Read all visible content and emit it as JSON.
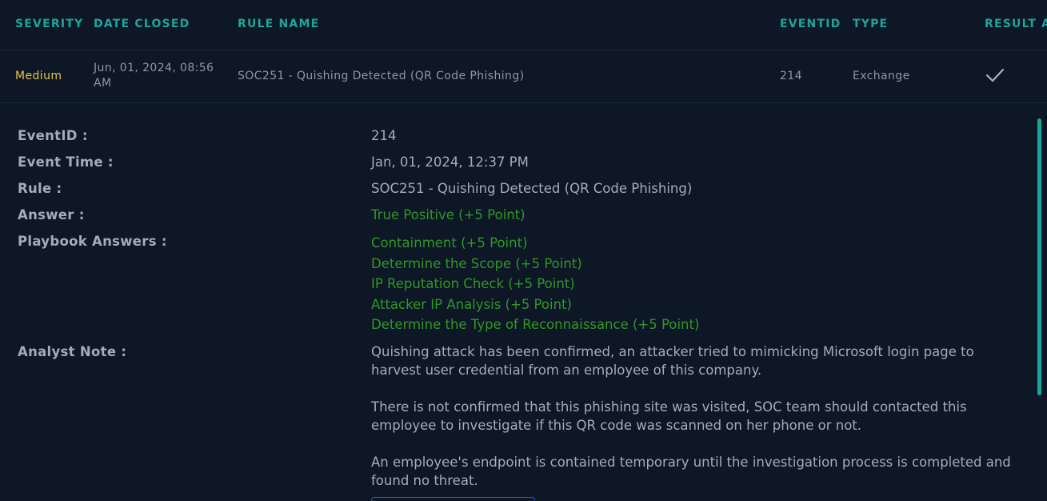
{
  "table": {
    "headers": {
      "severity": "SEVERITY",
      "date_closed": "DATE CLOSED",
      "rule_name": "RULE NAME",
      "eventid": "EVENTID",
      "type": "TYPE",
      "result": "RESULT",
      "next": "A"
    },
    "row": {
      "severity": "Medium",
      "date_closed": "Jun, 01, 2024, 08:56 AM",
      "rule_name": "SOC251 - Quishing Detected (QR Code Phishing)",
      "eventid": "214",
      "type": "Exchange",
      "result_icon": "checkmark-icon"
    }
  },
  "details": {
    "labels": {
      "eventid": "EventID :",
      "event_time": "Event Time :",
      "rule": "Rule :",
      "answer": "Answer :",
      "playbook_answers": "Playbook Answers :",
      "analyst_note": "Analyst Note :"
    },
    "values": {
      "eventid": "214",
      "event_time": "Jan, 01, 2024, 12:37 PM",
      "rule": "SOC251 - Quishing Detected (QR Code Phishing)",
      "answer": "True Positive (+5 Point)"
    },
    "playbook_answers": [
      "Containment (+5 Point)",
      "Determine the Scope (+5 Point)",
      "IP Reputation Check (+5 Point)",
      "Attacker IP Analysis (+5 Point)",
      "Determine the Type of Reconnaissance (+5 Point)"
    ],
    "analyst_note": [
      "Quishing attack has been confirmed, an attacker tried to mimicking Microsoft login page to harvest user credential from an employee of this company.",
      "There is not confirmed that this phishing site was visited, SOC team should contacted this employee to investigate if this QR code was scanned on her phone or not.",
      "An employee's endpoint is contained temporary until the investigation process is completed and found no threat."
    ]
  },
  "colors": {
    "background": "#0e1726",
    "header_accent": "#1ea59a",
    "severity_medium": "#e2c64a",
    "points_green": "#2f9726",
    "text_muted": "#a4acb8"
  }
}
